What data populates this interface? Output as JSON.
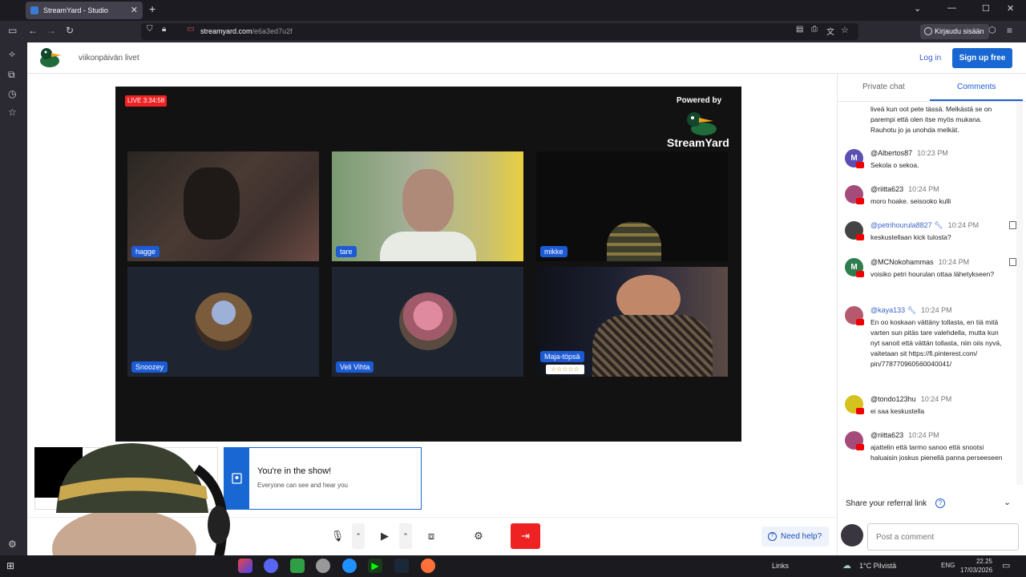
{
  "browser": {
    "tab_title": "StreamYard - Studio",
    "url_domain": "streamyard.com",
    "url_path": "/e6a3ed7u2f",
    "signin_label": "Kirjaudu sisään"
  },
  "header": {
    "broadcast_name": "viikonpäivän livet",
    "login_label": "Log in",
    "signup_label": "Sign up free"
  },
  "stage": {
    "live_timer": "LIVE 3:34:58",
    "powered_by": "Powered by",
    "brand": "StreamYard",
    "participants": [
      "hagge",
      "tare",
      "mikke",
      "Snoozey",
      "Veli Vihta",
      "Maja-töpsä"
    ],
    "badge_stars": "☆☆☆☆☆"
  },
  "toast": {
    "title": "You're in the show!",
    "subtitle": "Everyone can see and hear you"
  },
  "controls": {
    "help_label": "Need help?"
  },
  "panel": {
    "tab_private": "Private chat",
    "tab_comments": "Comments",
    "comments": [
      {
        "author": "",
        "time": "",
        "text": "liveä kun oot pete tässä. Melkästä se on parempi että olen itse myös mukana. Rauhotu jo ja unohda melkät."
      },
      {
        "author": "@Albertos87",
        "time": "10:23 PM",
        "text": "Sekola o sekoa.",
        "initial": "M",
        "color": "#5b4fb3"
      },
      {
        "author": "@riitta623",
        "time": "10:24 PM",
        "text": "moro hoake. seisooko kulli",
        "initial": "",
        "color": "#a44b7a"
      },
      {
        "author": "@petrihourula8827",
        "time": "10:24 PM",
        "text": "keskustellaan kick tulosta?",
        "initial": "",
        "color": "#444444"
      },
      {
        "author": "@MCNokohammas",
        "time": "10:24 PM",
        "text": "voisiko petri hourulan ottaa lähetykseen?",
        "initial": "M",
        "color": "#2e7d4f"
      },
      {
        "author": "@kaya133",
        "time": "10:24 PM",
        "text": "En oo koskaan vättäny tollasta, en tiä mitä varten sun pitäs tare valehdella, mutta kun nyt sanoit että vättän tollasta, niin oiis nyvä, vaitetaan sit https://fi.pinterest.com/ pin/778770960560040041/",
        "initial": "",
        "color": "#b55a6e"
      },
      {
        "author": "@tondo123hu",
        "time": "10:24 PM",
        "text": "ei saa keskustella",
        "initial": "",
        "color": "#d4c21e"
      },
      {
        "author": "@riitta623",
        "time": "10:24 PM",
        "text": "ajattelin että tarmo sanoo että snootsi haluaisin joskus pienellä panna perseeseen",
        "initial": "",
        "color": "#a44b7a"
      }
    ],
    "referral_label": "Share your referral link",
    "comment_placeholder": "Post a comment"
  },
  "taskbar": {
    "links_label": "Links",
    "weather": "1°C Pilvistä",
    "lang": "ENG",
    "time": "22.25",
    "date": "17/03/2026"
  }
}
